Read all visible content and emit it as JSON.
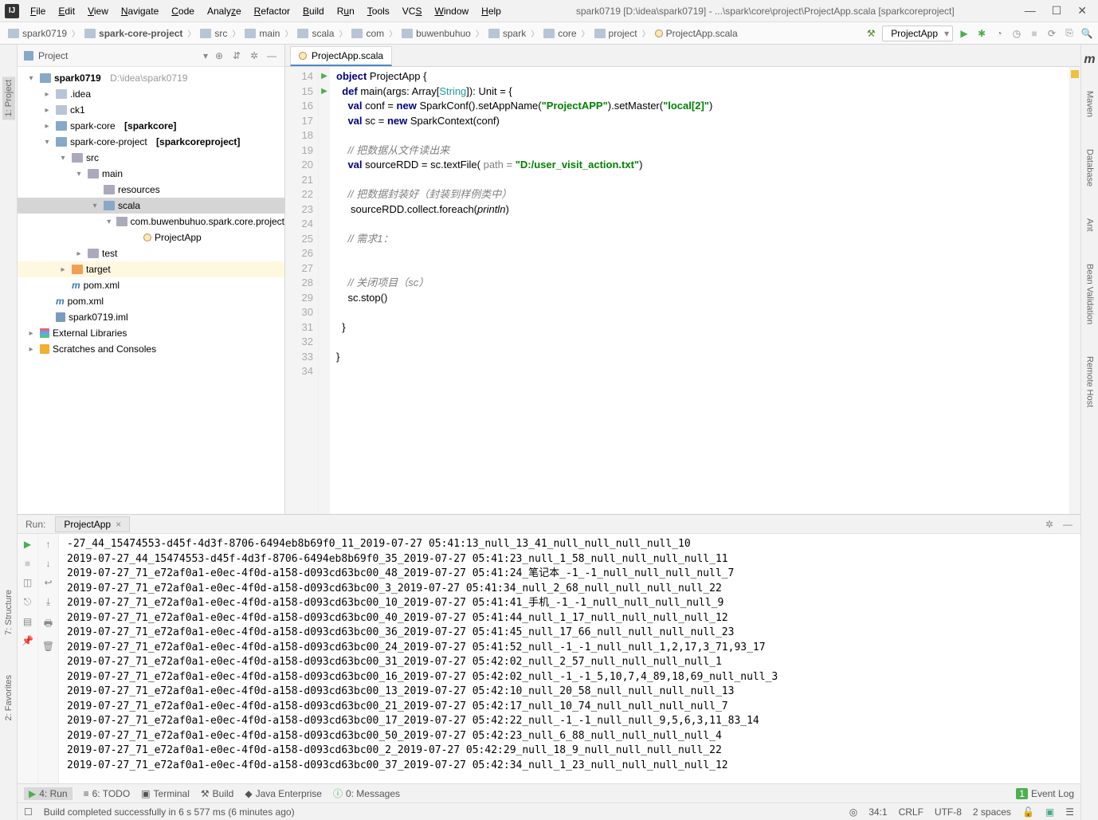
{
  "title_path": "spark0719 [D:\\idea\\spark0719] - ...\\spark\\core\\project\\ProjectApp.scala [sparkcoreproject]",
  "menus": {
    "file": "File",
    "edit": "Edit",
    "view": "View",
    "navigate": "Navigate",
    "code": "Code",
    "analyze": "Analyze",
    "refactor": "Refactor",
    "build": "Build",
    "run": "Run",
    "tools": "Tools",
    "vcs": "VCS",
    "window": "Window",
    "help": "Help"
  },
  "breadcrumbs": [
    "spark0719",
    "spark-core-project",
    "src",
    "main",
    "scala",
    "com",
    "buwenbuhuo",
    "spark",
    "core",
    "project",
    "ProjectApp.scala"
  ],
  "run_config": "ProjectApp",
  "project_pane_title": "Project",
  "tree": {
    "root": "spark0719",
    "root_path": "D:\\idea\\spark0719",
    "idea": ".idea",
    "ck1": "ck1",
    "sparkcore": "spark-core",
    "sparkcore_suffix": "[sparkcore]",
    "sparkcoreproject": "spark-core-project",
    "sparkcoreproject_suffix": "[sparkcoreproject]",
    "src": "src",
    "main": "main",
    "resources": "resources",
    "scala": "scala",
    "pkg": "com.buwenbuhuo.spark.core.project",
    "projectapp": "ProjectApp",
    "test": "test",
    "target": "target",
    "pomxml": "pom.xml",
    "pomxml2": "pom.xml",
    "iml": "spark0719.iml",
    "extlib": "External Libraries",
    "scratch": "Scratches and Consoles"
  },
  "editor_tab": "ProjectApp.scala",
  "code": {
    "lines": [
      14,
      15,
      16,
      17,
      18,
      19,
      20,
      21,
      22,
      23,
      24,
      25,
      26,
      27,
      28,
      29,
      30,
      31,
      32,
      33,
      34
    ],
    "l14_a": "object",
    "l14_b": " ProjectApp {",
    "l15_a": "  def ",
    "l15_b": "main",
    "l15_c": "(args: Array[",
    "l15_d": "String",
    "l15_e": "]): Unit = {",
    "l16_a": "    val ",
    "l16_b": "conf = ",
    "l16_c": "new ",
    "l16_d": "SparkConf().setAppName(",
    "l16_e": "\"ProjectAPP\"",
    "l16_f": ").setMaster(",
    "l16_g": "\"local[2]\"",
    "l16_h": ")",
    "l17_a": "    val ",
    "l17_b": "sc = ",
    "l17_c": "new ",
    "l17_d": "SparkContext(conf)",
    "l18": "",
    "l19": "    // 把数据从文件读出来",
    "l20_a": "    val ",
    "l20_b": "sourceRDD = sc.textFile( ",
    "l20_c": "path = ",
    "l20_d": "\"D:/user_visit_action.txt\"",
    "l20_e": ")",
    "l21": "",
    "l22": "    // 把数据封装好（封装到样例类中）",
    "l23_a": "     sourceRDD.collect.foreach(",
    "l23_b": "println",
    "l23_c": ")",
    "l24": "",
    "l25": "    // 需求1：",
    "l26": "",
    "l27": "",
    "l28": "    // 关闭项目（sc）",
    "l29": "    sc.stop()",
    "l30": "",
    "l31": "  }",
    "l32": "",
    "l33": "}",
    "l34": ""
  },
  "run": {
    "label": "Run:",
    "tab": "ProjectApp",
    "lines": [
      "-27_44_15474553-d45f-4d3f-8706-6494eb8b69f0_11_2019-07-27 05:41:13_null_13_41_null_null_null_null_10",
      "2019-07-27_44_15474553-d45f-4d3f-8706-6494eb8b69f0_35_2019-07-27 05:41:23_null_1_58_null_null_null_null_11",
      "2019-07-27_71_e72af0a1-e0ec-4f0d-a158-d093cd63bc00_48_2019-07-27 05:41:24_笔记本_-1_-1_null_null_null_null_7",
      "2019-07-27_71_e72af0a1-e0ec-4f0d-a158-d093cd63bc00_3_2019-07-27 05:41:34_null_2_68_null_null_null_null_22",
      "2019-07-27_71_e72af0a1-e0ec-4f0d-a158-d093cd63bc00_10_2019-07-27 05:41:41_手机_-1_-1_null_null_null_null_9",
      "2019-07-27_71_e72af0a1-e0ec-4f0d-a158-d093cd63bc00_40_2019-07-27 05:41:44_null_1_17_null_null_null_null_12",
      "2019-07-27_71_e72af0a1-e0ec-4f0d-a158-d093cd63bc00_36_2019-07-27 05:41:45_null_17_66_null_null_null_null_23",
      "2019-07-27_71_e72af0a1-e0ec-4f0d-a158-d093cd63bc00_24_2019-07-27 05:41:52_null_-1_-1_null_null_1,2,17,3_71,93_17",
      "2019-07-27_71_e72af0a1-e0ec-4f0d-a158-d093cd63bc00_31_2019-07-27 05:42:02_null_2_57_null_null_null_null_1",
      "2019-07-27_71_e72af0a1-e0ec-4f0d-a158-d093cd63bc00_16_2019-07-27 05:42:02_null_-1_-1_5,10,7,4_89,18,69_null_null_3",
      "2019-07-27_71_e72af0a1-e0ec-4f0d-a158-d093cd63bc00_13_2019-07-27 05:42:10_null_20_58_null_null_null_null_13",
      "2019-07-27_71_e72af0a1-e0ec-4f0d-a158-d093cd63bc00_21_2019-07-27 05:42:17_null_10_74_null_null_null_null_7",
      "2019-07-27_71_e72af0a1-e0ec-4f0d-a158-d093cd63bc00_17_2019-07-27 05:42:22_null_-1_-1_null_null_9,5,6,3,11_83_14",
      "2019-07-27_71_e72af0a1-e0ec-4f0d-a158-d093cd63bc00_50_2019-07-27 05:42:23_null_6_88_null_null_null_null_4",
      "2019-07-27_71_e72af0a1-e0ec-4f0d-a158-d093cd63bc00_2_2019-07-27 05:42:29_null_18_9_null_null_null_null_22",
      "2019-07-27_71_e72af0a1-e0ec-4f0d-a158-d093cd63bc00_37_2019-07-27 05:42:34_null_1_23_null_null_null_null_12"
    ]
  },
  "bottom": {
    "run": "4: Run",
    "todo": "6: TODO",
    "terminal": "Terminal",
    "build": "Build",
    "java": "Java Enterprise",
    "messages": "0: Messages",
    "eventlog": "Event Log",
    "eventcount": "1"
  },
  "status": {
    "msg": "Build completed successfully in 6 s 577 ms (6 minutes ago)",
    "pos": "34:1",
    "eol": "CRLF",
    "enc": "UTF-8",
    "indent": "2 spaces"
  },
  "sidebars": {
    "project": "1: Project",
    "structure": "7: Structure",
    "favorites": "2: Favorites",
    "maven": "Maven",
    "database": "Database",
    "ant": "Ant",
    "bean": "Bean Validation",
    "remote": "Remote Host"
  }
}
